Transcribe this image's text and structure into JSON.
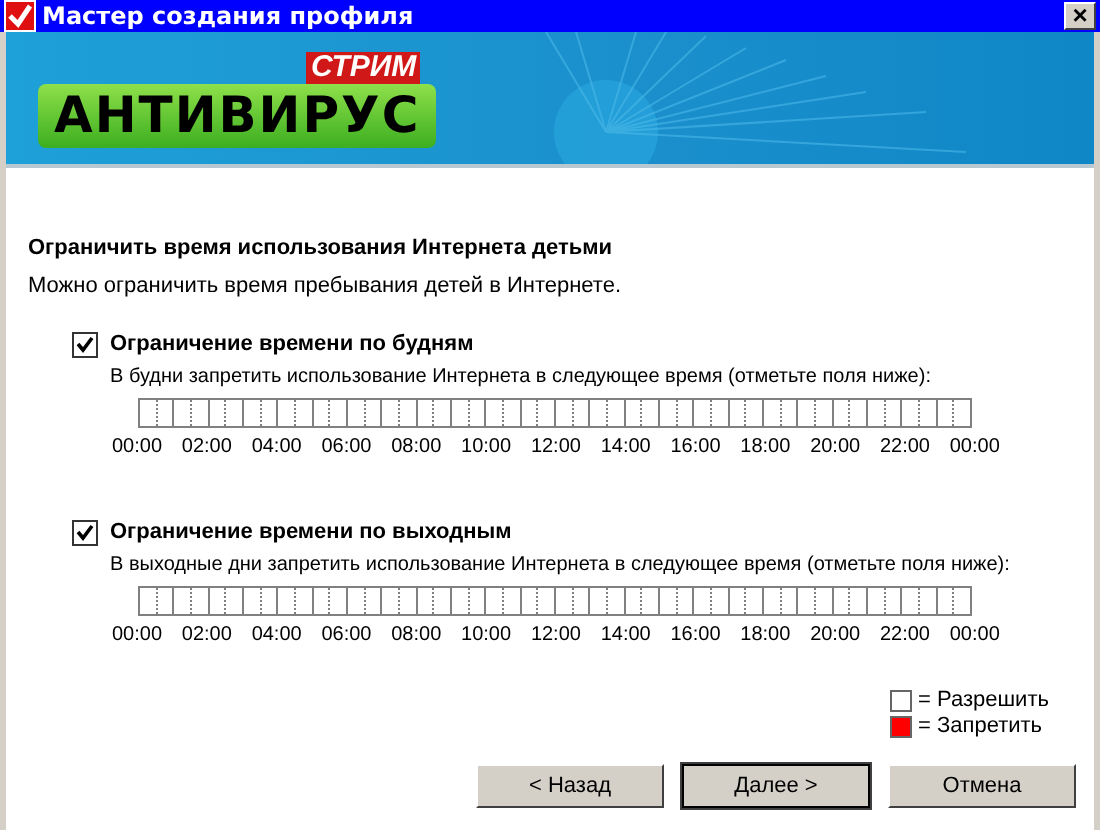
{
  "window": {
    "title": "Мастер создания профиля",
    "close": "×"
  },
  "banner": {
    "brand_small": "СТРИМ",
    "brand_big": "АНТИВИРУС"
  },
  "heading": "Ограничить время использования Интернета детьми",
  "description": "Можно ограничить время пребывания детей в Интернете.",
  "sections": [
    {
      "label": "Ограничение времени по будням",
      "checked": true,
      "hint": "В будни запретить использование Интернета в следующее время (отметьте поля ниже):",
      "hours": [
        false,
        false,
        false,
        false,
        false,
        false,
        false,
        false,
        false,
        false,
        false,
        false,
        false,
        false,
        false,
        false,
        false,
        false,
        false,
        false,
        false,
        false,
        false,
        false
      ],
      "ticks": [
        "00:00",
        "02:00",
        "04:00",
        "06:00",
        "08:00",
        "10:00",
        "12:00",
        "14:00",
        "16:00",
        "18:00",
        "20:00",
        "22:00",
        "00:00"
      ]
    },
    {
      "label": "Ограничение времени по выходным",
      "checked": true,
      "hint": "В выходные дни запретить использование Интернета в следующее время (отметьте поля ниже):",
      "hours": [
        false,
        false,
        false,
        false,
        false,
        false,
        false,
        false,
        false,
        false,
        false,
        false,
        false,
        false,
        false,
        false,
        false,
        false,
        false,
        false,
        false,
        false,
        false,
        false
      ],
      "ticks": [
        "00:00",
        "02:00",
        "04:00",
        "06:00",
        "08:00",
        "10:00",
        "12:00",
        "14:00",
        "16:00",
        "18:00",
        "20:00",
        "22:00",
        "00:00"
      ]
    }
  ],
  "legend": [
    {
      "label": "= Разрешить",
      "color": "#ffffff"
    },
    {
      "label": "= Запретить",
      "color": "#ff0000"
    }
  ],
  "buttons": [
    {
      "label": "< Назад",
      "default": false
    },
    {
      "label": "Далее >",
      "default": true
    },
    {
      "label": "Отмена",
      "default": false
    }
  ]
}
